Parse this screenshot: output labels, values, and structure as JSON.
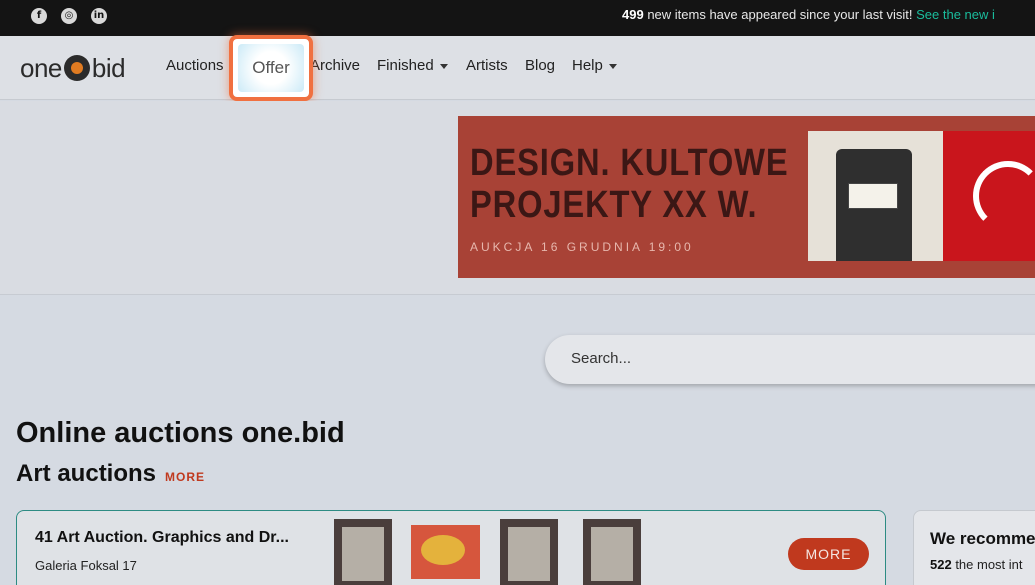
{
  "topbar": {
    "social_icons": [
      "facebook-icon",
      "instagram-icon",
      "linkedin-icon"
    ],
    "count": "499",
    "message": " new items have appeared since your last visit! ",
    "link": "See the new i"
  },
  "nav": {
    "logo_left": "one",
    "logo_right": "bid",
    "items": [
      {
        "label": "Auctions"
      },
      {
        "label": "Offer"
      },
      {
        "label": "Archive"
      },
      {
        "label": "Finished",
        "dropdown": true
      },
      {
        "label": "Artists"
      },
      {
        "label": "Blog"
      },
      {
        "label": "Help",
        "dropdown": true
      }
    ],
    "highlighted": "Offer"
  },
  "banner": {
    "title_line1": "DESIGN. KULTOWE",
    "title_line2": "PROJEKTY XX W.",
    "subtitle": "AUKCJA 16 GRUDNIA 19:00",
    "bg_color": "#a84236"
  },
  "search": {
    "placeholder": "Search..."
  },
  "main": {
    "heading": "Online auctions one.bid",
    "section_title": "Art auctions",
    "section_more": "MORE"
  },
  "auction_card": {
    "title": "41 Art Auction. Graphics and Dr...",
    "house": "Galeria Foksal 17",
    "more_label": "MORE",
    "accent": "#c0391e"
  },
  "recommend_card": {
    "title": "We recomme",
    "count": "522",
    "text": " the most int"
  },
  "colors": {
    "accent_red": "#c0391e",
    "teal_link": "#1abc9c",
    "highlight": "#f07040"
  }
}
